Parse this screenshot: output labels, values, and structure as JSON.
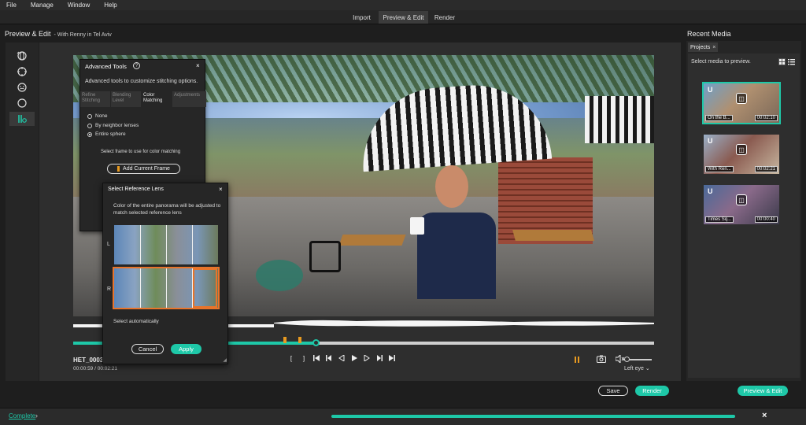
{
  "menu": [
    "File",
    "Manage",
    "Window",
    "Help"
  ],
  "mode_tabs": [
    "Import",
    "Preview & Edit",
    "Render"
  ],
  "left_panel": {
    "title": "Preview & Edit",
    "subtitle": "- With Renny in Tel Aviv"
  },
  "right_panel": {
    "title": "Recent Media",
    "tab_label": "Projects",
    "tab_close": "×",
    "hint": "Select media to preview."
  },
  "player": {
    "clip_name": "HET_0003(2",
    "time": "00:00:59 / 00:02:21",
    "transport": [
      "[",
      "]",
      "⏮",
      "⏪",
      "◀",
      "▶",
      "▶",
      "⏩",
      "⏭"
    ],
    "eye_label": "Left eye",
    "progress_fraction": 0.418,
    "markers": [
      0.365,
      0.39
    ],
    "volume_fraction": 0.1
  },
  "actions": {
    "save": "Save",
    "render": "Render",
    "preview_edit": "Preview & Edit"
  },
  "advanced_tools": {
    "title": "Advanced Tools",
    "help": "?",
    "close": "×",
    "description": "Advanced tools to customize stitching options.",
    "tabs": [
      "Refine Stitching",
      "Blending Level",
      "Color Matching",
      "Adjustments"
    ],
    "options": [
      "None",
      "By neighbor lenses",
      "Entire sphere"
    ],
    "selected_option": 2,
    "hint": "Select frame to use for color matching",
    "add_frame_label": "Add Current Frame"
  },
  "reference_lens": {
    "title": "Select Reference Lens",
    "close": "×",
    "description": "Color of the entire panorama will be adjusted to match selected reference lens",
    "left_label": "L",
    "right_label": "R",
    "auto_label": "Select automatically",
    "cancel": "Cancel",
    "apply": "Apply"
  },
  "media": [
    {
      "name": "On the B...",
      "duration": "00:02:10",
      "selected": true
    },
    {
      "name": "With Ren...",
      "duration": "00:02:21",
      "selected": false
    },
    {
      "name": "Times Sq...",
      "duration": "00:00:40",
      "selected": false
    }
  ],
  "status": {
    "link": "Complete",
    "progress_fraction": 1.0,
    "close": "×"
  },
  "colors": {
    "accent": "#1ec8a8",
    "marker": "#e89a20",
    "lens_select": "#e8742a"
  }
}
